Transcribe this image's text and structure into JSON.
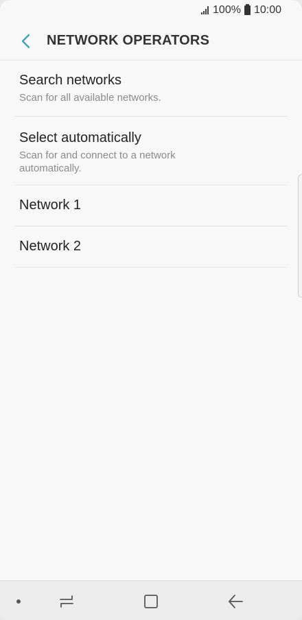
{
  "status_bar": {
    "battery_percent": "100%",
    "time": "10:00"
  },
  "header": {
    "title": "NETWORK OPERATORS"
  },
  "list": {
    "items": [
      {
        "title": "Search networks",
        "subtitle": "Scan for all available networks."
      },
      {
        "title": "Select automatically",
        "subtitle": "Scan for and connect to a network automatically."
      },
      {
        "title": "Network 1"
      },
      {
        "title": "Network 2"
      }
    ]
  },
  "colors": {
    "accent": "#4a9bb5",
    "background": "#f8f8f8",
    "nav_bar": "#ececec"
  },
  "icons": {
    "back": "chevron-left-icon",
    "signal": "signal-icon",
    "battery": "battery-icon",
    "nav_recent": "recent-apps-icon",
    "nav_home": "home-icon",
    "nav_back": "back-arrow-icon"
  }
}
